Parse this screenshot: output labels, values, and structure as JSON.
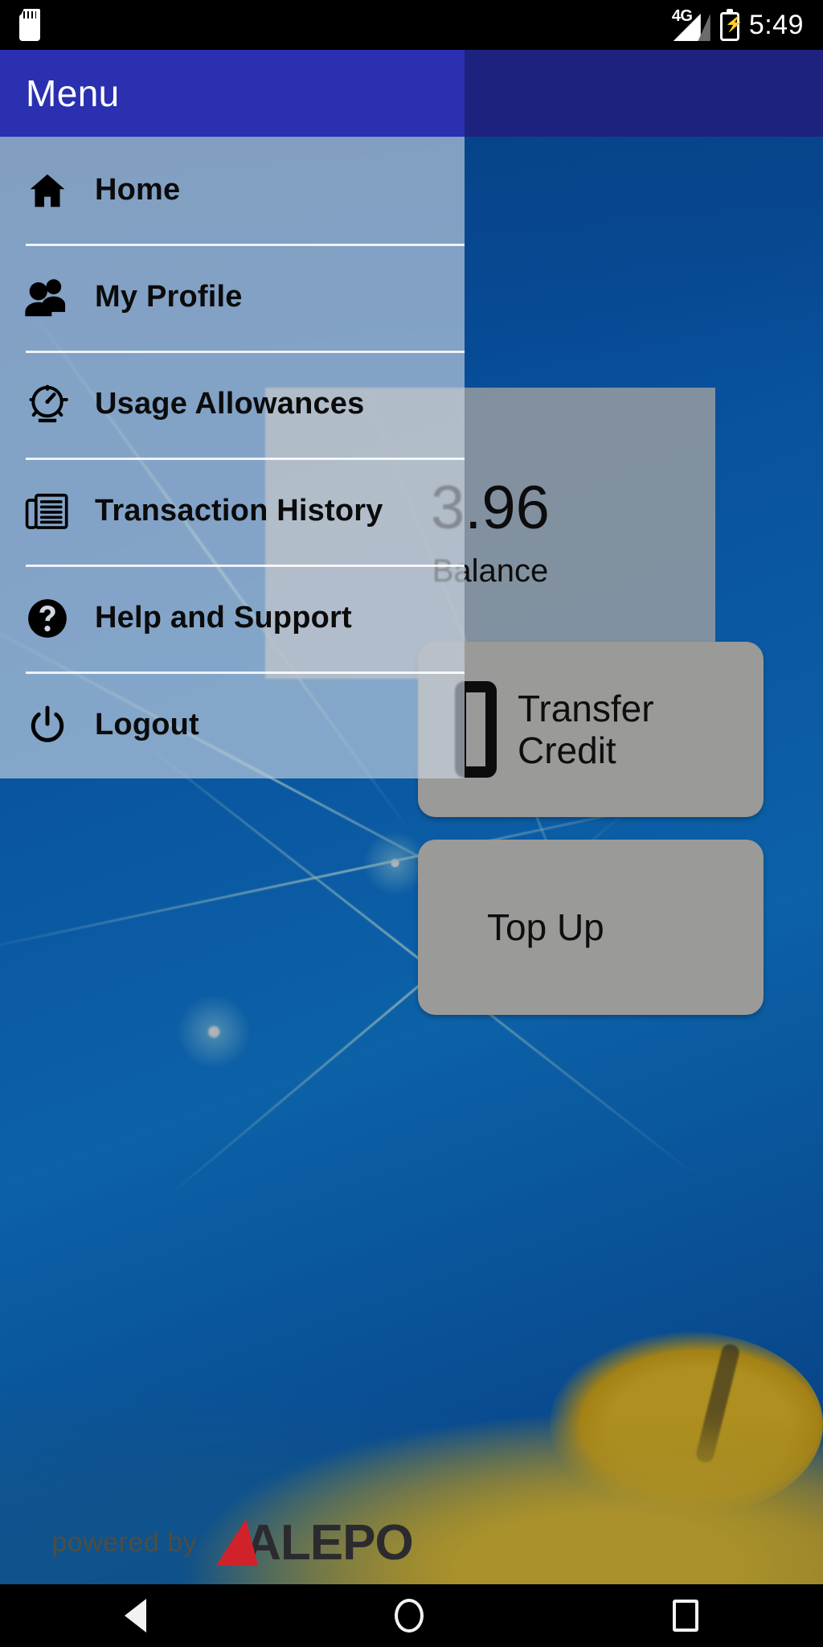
{
  "status_bar": {
    "sd_card_icon": "sd-card-icon",
    "network_label": "4G",
    "signal_icon": "signal-bars-icon",
    "battery_icon": "battery-charging-icon",
    "time": "5:49"
  },
  "drawer": {
    "title": "Menu",
    "items": [
      {
        "label": "Home",
        "icon": "home-icon"
      },
      {
        "label": "My Profile",
        "icon": "people-icon"
      },
      {
        "label": "Usage Allowances",
        "icon": "speedometer-icon"
      },
      {
        "label": "Transaction History",
        "icon": "newspaper-icon"
      },
      {
        "label": "Help and Support",
        "icon": "help-circle-icon"
      },
      {
        "label": "Logout",
        "icon": "power-icon"
      }
    ]
  },
  "content": {
    "balance_amount": "3.96",
    "balance_label": "Balance",
    "buttons": [
      {
        "label_line1": "Transfer",
        "label_line2": "Credit",
        "icon": "phone-icon"
      },
      {
        "label_line1": "Top Up",
        "label_line2": "",
        "icon": "topup-icon"
      }
    ]
  },
  "footer": {
    "powered_by": "powered by",
    "brand_name": "ALEPO"
  },
  "nav_bar": {
    "back": "back-icon",
    "home": "home-circle-icon",
    "recents": "recents-square-icon"
  },
  "colors": {
    "app_bar": "#2A30B0",
    "drawer_panel": "#CED8E4",
    "brand_red": "#D1222B",
    "background_blue": "#0F7AE0"
  }
}
